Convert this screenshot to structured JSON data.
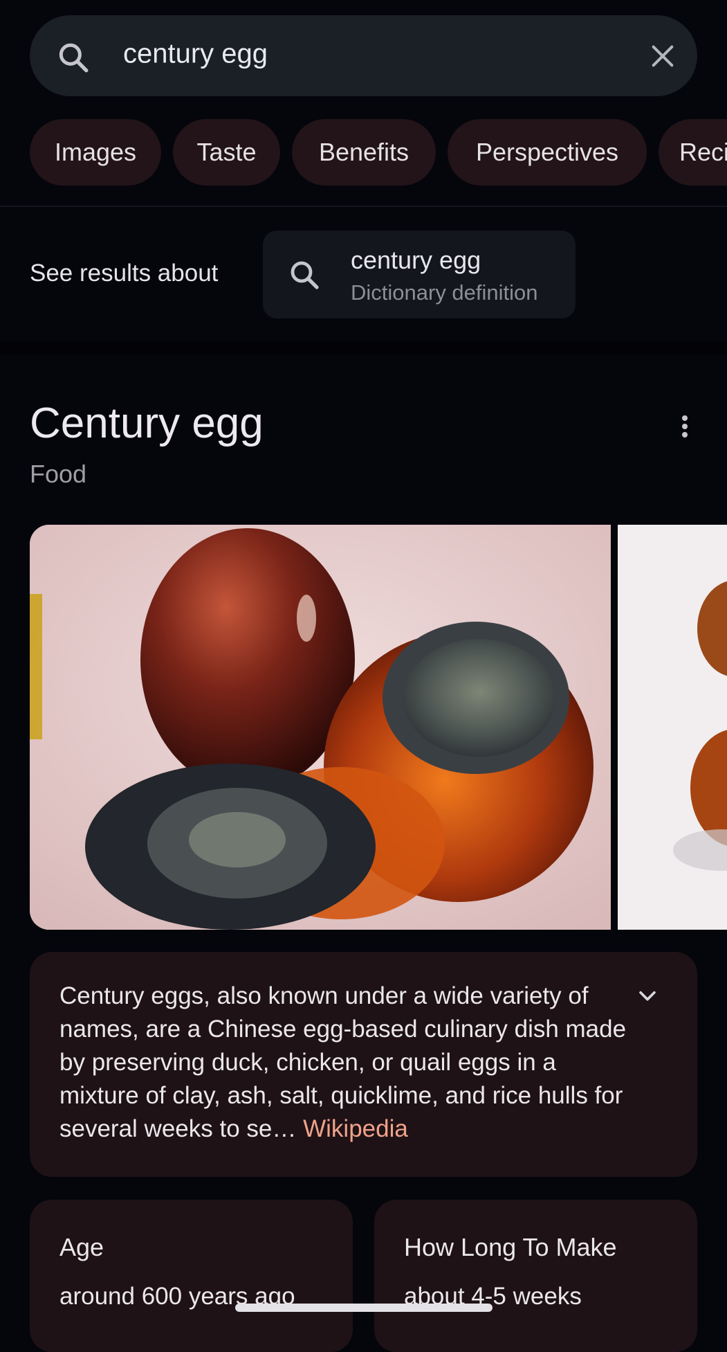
{
  "search": {
    "query": "century egg",
    "icon": "search-icon",
    "clear_icon": "close-icon"
  },
  "chips": [
    {
      "label": "Images"
    },
    {
      "label": "Taste"
    },
    {
      "label": "Benefits"
    },
    {
      "label": "Perspectives"
    },
    {
      "label": "Reci"
    }
  ],
  "see_results": {
    "label": "See results about",
    "item_title": "century egg",
    "item_subtitle": "Dictionary definition"
  },
  "knowledge_panel": {
    "title": "Century egg",
    "subtitle": "Food",
    "more_icon": "more-vert-icon",
    "description": "Century eggs, also known under a wide variety of names, are a Chinese egg-based culinary dish made by preserving duck, chicken, or quail eggs in a mixture of clay, ash, salt, quicklime, and rice hulls for several weeks to se…",
    "source": "Wikipedia",
    "expand_icon": "chevron-down-icon",
    "facts": [
      {
        "label": "Age",
        "value": "around 600 years ago"
      },
      {
        "label": "How Long To Make",
        "value": "about 4-5 weeks"
      }
    ]
  },
  "colors": {
    "background": "#05050c",
    "chip_background": "#221418",
    "card_background": "#1e1216",
    "source_link": "#f0a28a"
  }
}
